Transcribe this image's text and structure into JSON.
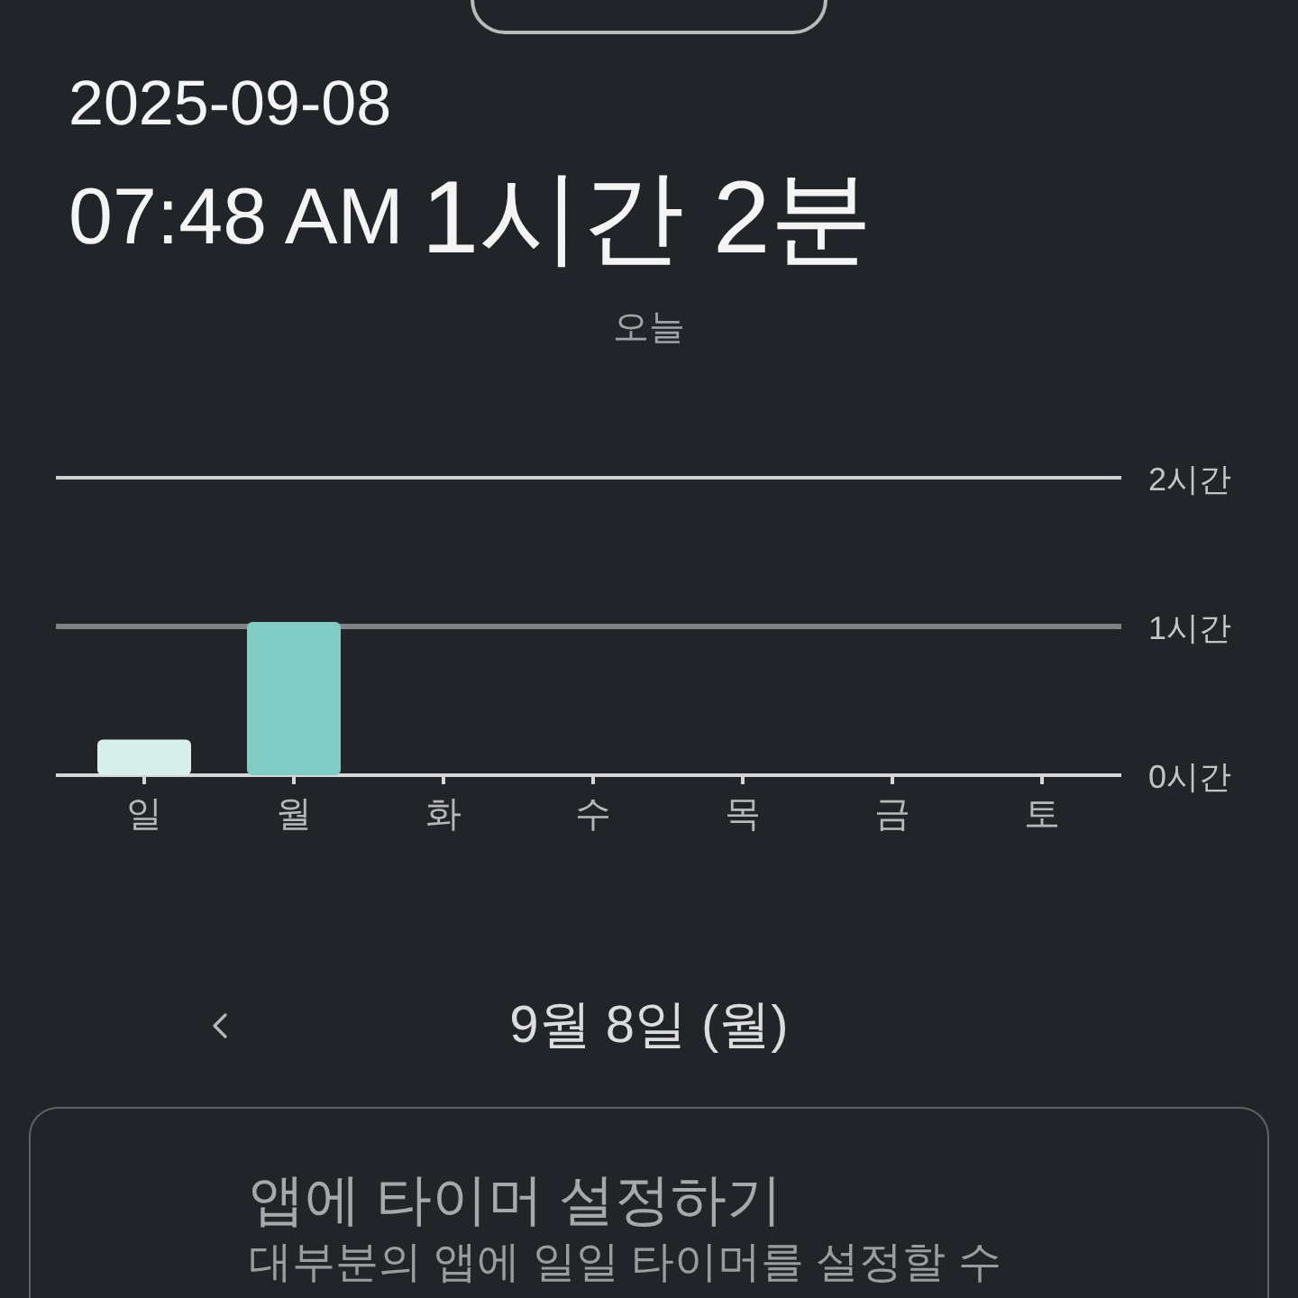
{
  "header": {
    "date": "2025-09-08",
    "time": "07:48 AM",
    "total_usage": "1시간 2분",
    "period": "오늘"
  },
  "chart": {
    "chart_data": {
      "type": "bar",
      "categories": [
        "일",
        "월",
        "화",
        "수",
        "목",
        "금",
        "토"
      ],
      "series": [
        {
          "color": "#d9efec",
          "values": [
            0.24,
            null,
            null,
            null,
            null,
            null,
            null
          ]
        },
        {
          "color": "#80cbc4",
          "values": [
            null,
            1.03,
            null,
            null,
            null,
            null,
            null
          ]
        }
      ],
      "stacked": true,
      "ylim": [
        0,
        2
      ],
      "yticks": [
        {
          "value": 0,
          "label": "0시간"
        },
        {
          "value": 1,
          "label": "1시간"
        },
        {
          "value": 2,
          "label": "2시간"
        }
      ]
    }
  },
  "date_nav": {
    "label": "9월 8일 (월)"
  },
  "timer_card": {
    "title": "앱에 타이머 설정하기",
    "description": "대부분의 앱에 일일 타이머를 설정할 수"
  }
}
